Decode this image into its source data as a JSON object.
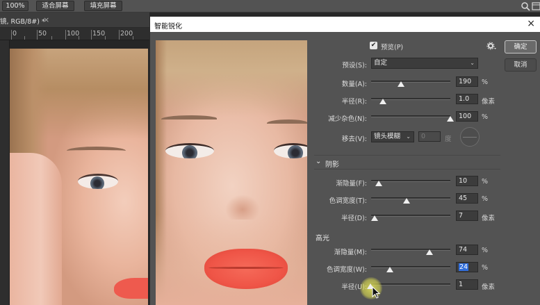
{
  "toolbar": {
    "zoom_button": "100%",
    "fit_screen": "适合屏幕",
    "fill_screen": "填充屏幕"
  },
  "document": {
    "tab_label": "镜, RGB/8#) *",
    "tab_close": "×",
    "ruler_ticks": [
      "0",
      "50",
      "100",
      "150",
      "200"
    ]
  },
  "dialog": {
    "title": "智能锐化",
    "close": "×",
    "ok": "确定",
    "cancel": "取消",
    "preview_label": "预览(P)",
    "preview_checked": true,
    "preset": {
      "label": "预设(S):",
      "value": "自定"
    },
    "amount": {
      "label": "数量(A):",
      "value": "190",
      "unit": "%",
      "fraction": 0.38
    },
    "radius": {
      "label": "半径(R):",
      "value": "1.0",
      "unit": "像素",
      "fraction": 0.15
    },
    "noise": {
      "label": "减少杂色(N):",
      "value": "100",
      "unit": "%",
      "fraction": 1.0
    },
    "remove": {
      "label": "移去(V):",
      "value": "镜头模糊",
      "angle": "0",
      "angle_unit": "度"
    },
    "shadows": {
      "title": "阴影",
      "fade": {
        "label": "渐隐量(F):",
        "value": "10",
        "unit": "%",
        "fraction": 0.1
      },
      "tonal": {
        "label": "色调宽度(T):",
        "value": "45",
        "unit": "%",
        "fraction": 0.45
      },
      "radius": {
        "label": "半径(D):",
        "value": "7",
        "unit": "像素",
        "fraction": 0.04
      }
    },
    "highlights": {
      "title": "高光",
      "fade": {
        "label": "渐隐量(M):",
        "value": "74",
        "unit": "%",
        "fraction": 0.74
      },
      "tonal": {
        "label": "色调宽度(W):",
        "value": "24",
        "unit": "%",
        "fraction": 0.24
      },
      "radius": {
        "label": "半径(U):",
        "value": "1",
        "unit": "像素",
        "fraction": 0.0
      }
    }
  },
  "colors": {
    "panel_bg": "#535353",
    "accent_selection": "#2f6ddb",
    "cursor_highlight": "#e8e85a"
  }
}
